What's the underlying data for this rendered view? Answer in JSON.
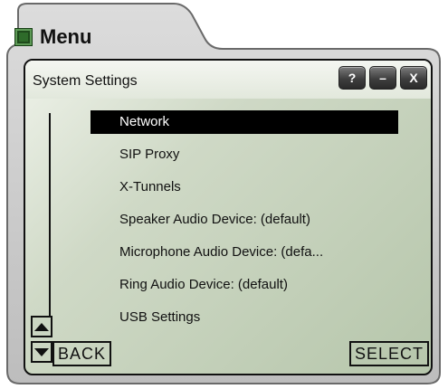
{
  "window": {
    "title": "Menu",
    "icon": "app-grid-icon"
  },
  "screen": {
    "title": "System Settings",
    "buttons": {
      "help": "?",
      "minimize": "–",
      "close": "X"
    }
  },
  "menu": {
    "items": [
      {
        "label": "Network",
        "selected": true
      },
      {
        "label": "SIP Proxy"
      },
      {
        "label": "X-Tunnels"
      },
      {
        "label": "Speaker Audio Device: (default)"
      },
      {
        "label": "Microphone Audio Device: (defa..."
      },
      {
        "label": "Ring Audio Device: (default)"
      },
      {
        "label": "USB Settings"
      }
    ]
  },
  "softkeys": {
    "back": "BACK",
    "select": "SELECT"
  },
  "colors": {
    "frame": "#c9c9c9",
    "lcd": "#b6c6ab",
    "selected_bg": "#000000"
  }
}
